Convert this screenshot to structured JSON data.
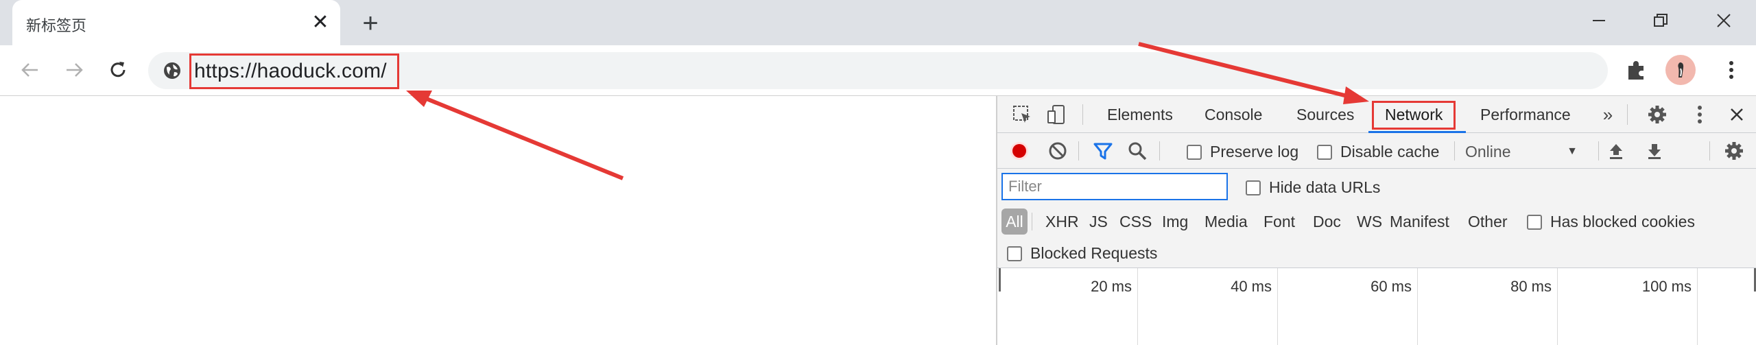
{
  "browser": {
    "tab": {
      "title": "新标签页"
    },
    "toolbar": {
      "url": "https://haoduck.com/"
    }
  },
  "devtools": {
    "tabs": [
      {
        "label": "Elements"
      },
      {
        "label": "Console"
      },
      {
        "label": "Sources"
      },
      {
        "label": "Network",
        "active": true
      },
      {
        "label": "Performance"
      }
    ],
    "toolbar": {
      "preserve_log": "Preserve log",
      "disable_cache": "Disable cache",
      "throttle": "Online"
    },
    "filter": {
      "placeholder": "Filter",
      "hide_data_urls": "Hide data URLs",
      "types": [
        "All",
        "XHR",
        "JS",
        "CSS",
        "Img",
        "Media",
        "Font",
        "Doc",
        "WS",
        "Manifest",
        "Other"
      ],
      "has_blocked_cookies": "Has blocked cookies",
      "blocked_requests": "Blocked Requests"
    },
    "timeline": {
      "ticks": [
        "20 ms",
        "40 ms",
        "60 ms",
        "80 ms",
        "100 ms"
      ]
    }
  },
  "colors": {
    "accent": "#1a73e8",
    "annotation": "#e53935",
    "record": "#d50000"
  }
}
